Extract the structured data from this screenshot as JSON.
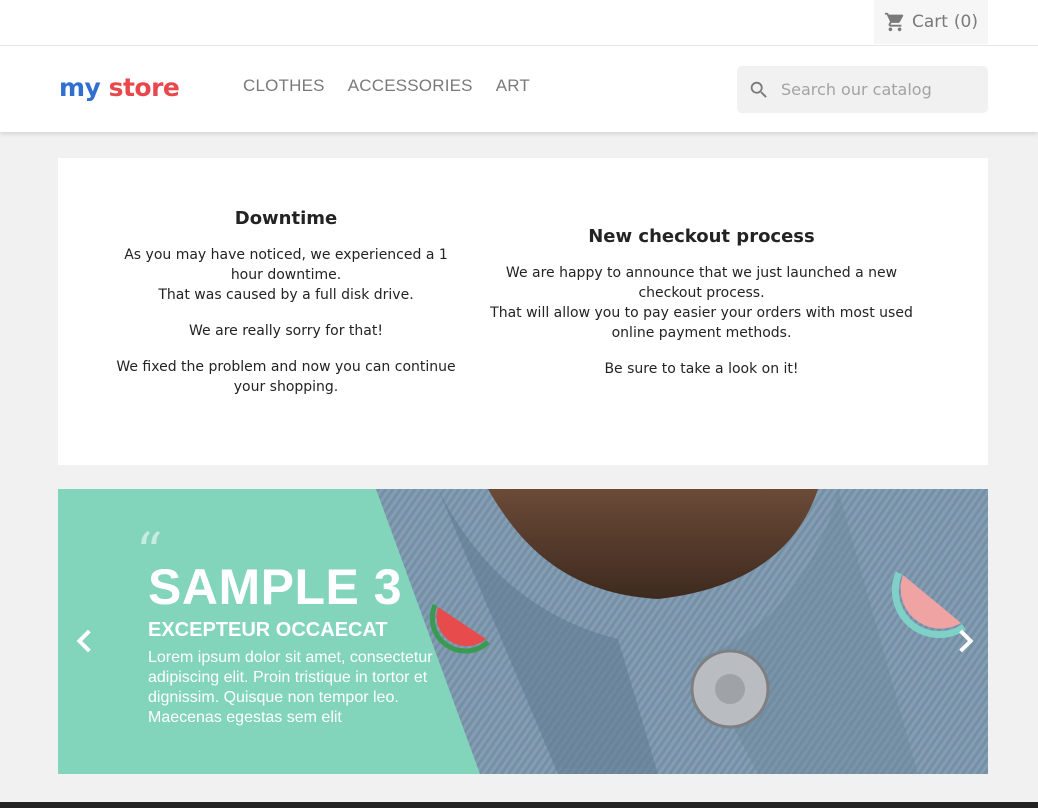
{
  "topbar": {
    "cart_label": "Cart",
    "cart_count": "(0)"
  },
  "header": {
    "logo": {
      "my": "my",
      "store": "store"
    },
    "nav": [
      "CLOTHES",
      "ACCESSORIES",
      "ART"
    ],
    "search": {
      "placeholder": "Search our catalog",
      "value": ""
    }
  },
  "news": [
    {
      "title": "Downtime",
      "paragraphs": [
        "As you may have noticed, we experienced a 1 hour downtime.",
        "That was caused by a full disk drive.",
        "We are really sorry for that!",
        "We fixed the problem and now you can continue your shopping."
      ]
    },
    {
      "title": "New checkout process",
      "paragraphs": [
        "We are happy to announce that we just launched a new checkout process.",
        "That will allow you to pay easier your orders with most used online payment methods.",
        "Be sure to take a look on it!"
      ]
    }
  ],
  "slider": {
    "title": "SAMPLE 3",
    "subtitle": "EXCEPTEUR OCCAECAT",
    "description": "Lorem ipsum dolor sit amet, consectetur adipiscing elit. Proin tristique in tortor et dignissim. Quisque non tempor leo. Maecenas egestas sem elit",
    "accent_color": "#82d4bb"
  },
  "icons": {
    "cart": "cart-icon",
    "search": "search-icon",
    "prev": "chevron-left-icon",
    "next": "chevron-right-icon"
  }
}
